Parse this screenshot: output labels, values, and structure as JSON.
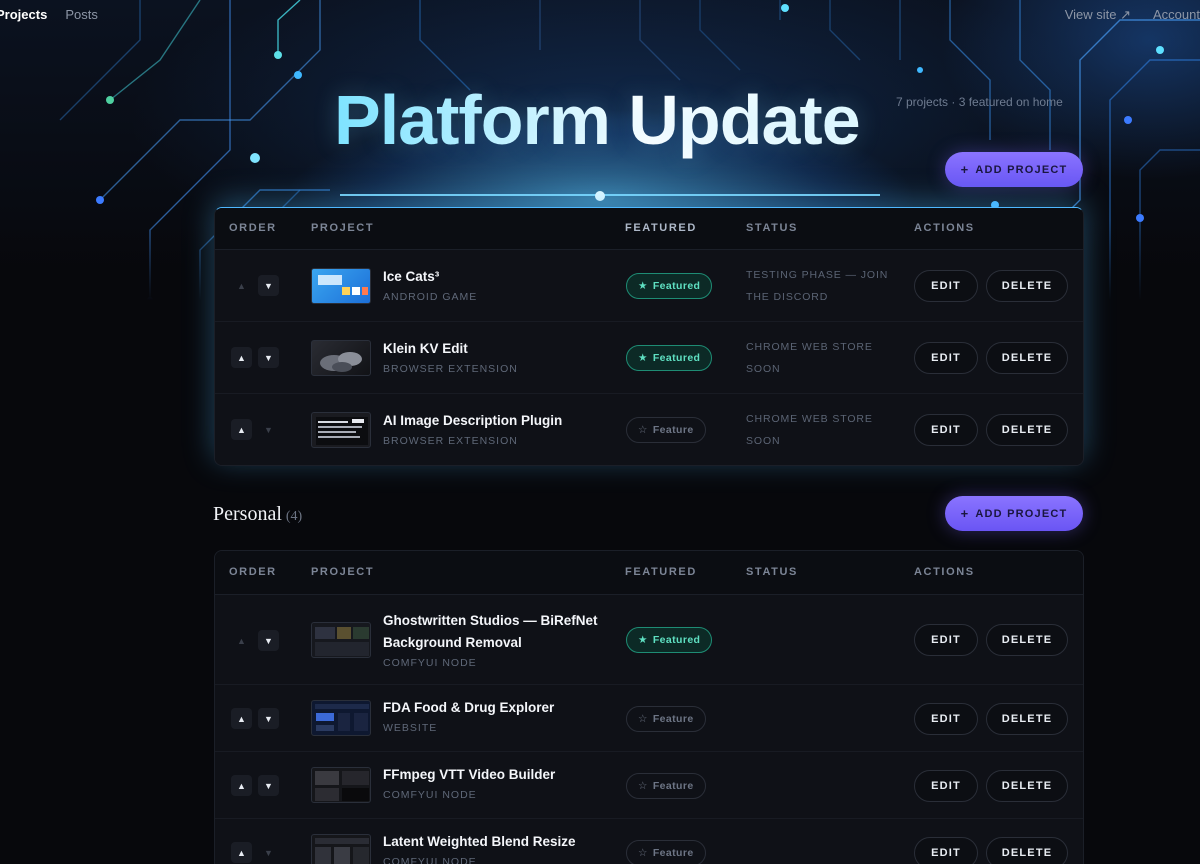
{
  "nav": {
    "left": [
      {
        "label": "Projects",
        "active": true
      },
      {
        "label": "Posts",
        "active": false
      }
    ],
    "right": [
      {
        "label": "View site ↗"
      },
      {
        "label": "Account"
      }
    ]
  },
  "hero": {
    "title": "Platform Update",
    "project_count": "7 projects · 3 featured on home"
  },
  "add_button_label": "ADD PROJECT",
  "table_headers": {
    "order": "ORDER",
    "project": "PROJECT",
    "featured": "FEATURED",
    "status": "STATUS",
    "actions": "ACTIONS"
  },
  "actions": {
    "edit": "EDIT",
    "delete": "DELETE"
  },
  "featured_labels": {
    "on": "Featured",
    "off": "Feature"
  },
  "sections": [
    {
      "title": "",
      "rows": [
        {
          "title": "Ice Cats³",
          "type": "ANDROID GAME",
          "featured": true,
          "status": "TESTING PHASE — JOIN THE DISCORD"
        },
        {
          "title": "Klein KV Edit",
          "type": "BROWSER EXTENSION",
          "featured": true,
          "status": "CHROME WEB STORE SOON"
        },
        {
          "title": "AI Image Description Plugin",
          "type": "BROWSER EXTENSION",
          "featured": false,
          "status": "CHROME WEB STORE SOON"
        }
      ]
    },
    {
      "title": "Personal",
      "count": "(4)",
      "rows": [
        {
          "title_line1": "Ghostwritten Studios — BiRefNet",
          "title_line2": "Background Removal",
          "type": "COMFYUI NODE",
          "featured": true,
          "status": ""
        },
        {
          "title": "FDA Food & Drug Explorer",
          "type": "WEBSITE",
          "featured": false,
          "status": ""
        },
        {
          "title": "FFmpeg VTT Video Builder",
          "type": "COMFYUI NODE",
          "featured": false,
          "status": ""
        },
        {
          "title": "Latent Weighted Blend Resize",
          "type": "COMFYUI NODE",
          "featured": false,
          "status": ""
        }
      ]
    }
  ],
  "colors": {
    "accent": "#7a64ff",
    "featured_green": "#5fe0c2",
    "background": "#07080c",
    "panel": "#0e1016"
  },
  "icons": {
    "up": "▲",
    "down": "▼",
    "star": "★",
    "star_outline": "☆",
    "plus": "+"
  }
}
